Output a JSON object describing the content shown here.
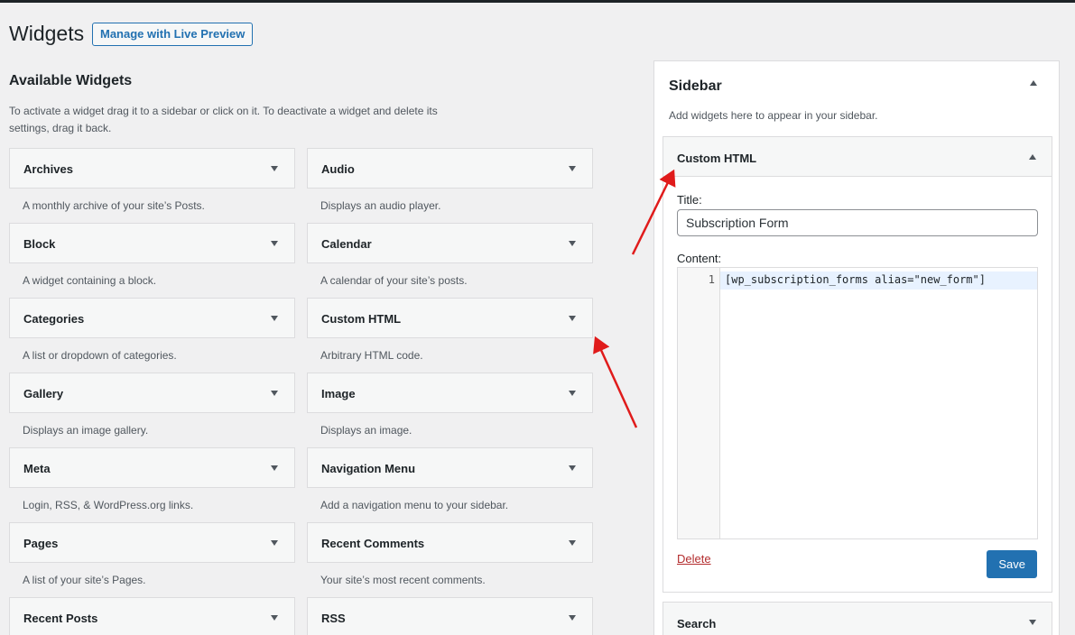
{
  "header": {
    "title": "Widgets",
    "live_preview_label": "Manage with Live Preview"
  },
  "available": {
    "title": "Available Widgets",
    "description": "To activate a widget drag it to a sidebar or click on it. To deactivate a widget and delete its settings, drag it back."
  },
  "widgets": [
    {
      "title": "Archives",
      "desc": "A monthly archive of your site’s Posts."
    },
    {
      "title": "Audio",
      "desc": "Displays an audio player."
    },
    {
      "title": "Block",
      "desc": "A widget containing a block."
    },
    {
      "title": "Calendar",
      "desc": "A calendar of your site’s posts."
    },
    {
      "title": "Categories",
      "desc": "A list or dropdown of categories."
    },
    {
      "title": "Custom HTML",
      "desc": "Arbitrary HTML code."
    },
    {
      "title": "Gallery",
      "desc": "Displays an image gallery."
    },
    {
      "title": "Image",
      "desc": "Displays an image."
    },
    {
      "title": "Meta",
      "desc": "Login, RSS, & WordPress.org links."
    },
    {
      "title": "Navigation Menu",
      "desc": "Add a navigation menu to your sidebar."
    },
    {
      "title": "Pages",
      "desc": "A list of your site’s Pages."
    },
    {
      "title": "Recent Comments",
      "desc": "Your site’s most recent comments."
    },
    {
      "title": "Recent Posts",
      "desc": ""
    },
    {
      "title": "RSS",
      "desc": ""
    }
  ],
  "sidebar": {
    "title": "Sidebar",
    "description": "Add widgets here to appear in your sidebar.",
    "custom_html": {
      "title": "Custom HTML",
      "title_label": "Title:",
      "title_value": "Subscription Form",
      "content_label": "Content:",
      "line_number": "1",
      "code": "[wp_subscription_forms alias=\"new_form\"]",
      "delete_label": "Delete",
      "save_label": "Save"
    },
    "search_widget": {
      "title": "Search"
    }
  },
  "colors": {
    "accent": "#2271b1",
    "annotation_arrow": "#e01b1b",
    "delete": "#b32d2e"
  }
}
